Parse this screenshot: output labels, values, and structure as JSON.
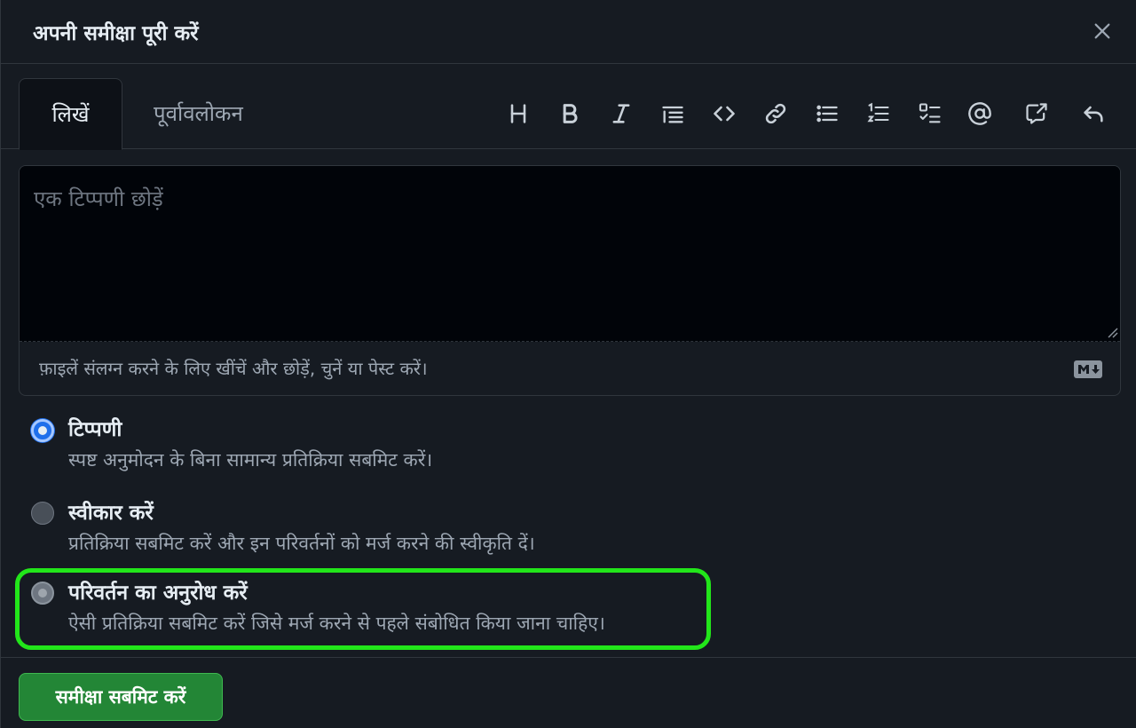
{
  "dialog": {
    "title": "अपनी समीक्षा पूरी करें",
    "close_icon": "close-icon"
  },
  "tabs": {
    "write": "लिखें",
    "preview": "पूर्वावलोकन"
  },
  "toolbar": [
    "heading-icon",
    "bold-icon",
    "italic-icon",
    "quote-icon",
    "code-icon",
    "link-icon",
    "unordered-list-icon",
    "ordered-list-icon",
    "task-list-icon",
    "mention-icon",
    "cross-reference-icon",
    "undo-icon"
  ],
  "editor": {
    "placeholder": "एक टिप्पणी छोड़ें",
    "attach_hint": "फ़ाइलें संलग्न करने के लिए खींचें और छोड़ें, चुनें या पेस्ट करें।",
    "markdown_badge": "markdown-icon"
  },
  "options": [
    {
      "label": "टिप्पणी",
      "description": "स्पष्ट अनुमोदन के बिना सामान्य प्रतिक्रिया सबमिट करें।",
      "checked": true
    },
    {
      "label": "स्वीकार करें",
      "description": "प्रतिक्रिया सबमिट करें और इन परिवर्तनों को मर्ज करने की स्वीकृति दें।",
      "checked": false
    },
    {
      "label": "परिवर्तन का अनुरोध करें",
      "description": "ऐसी प्रतिक्रिया सबमिट करें जिसे मर्ज करने से पहले संबोधित किया जाना चाहिए।",
      "checked": false,
      "highlighted": true
    }
  ],
  "submit_label": "समीक्षा सबमिट करें",
  "colors": {
    "background": "#161b22",
    "editor_bg": "#010409",
    "accent_radio": "#1f6feb",
    "submit": "#238636",
    "highlight": "#22e61a"
  }
}
